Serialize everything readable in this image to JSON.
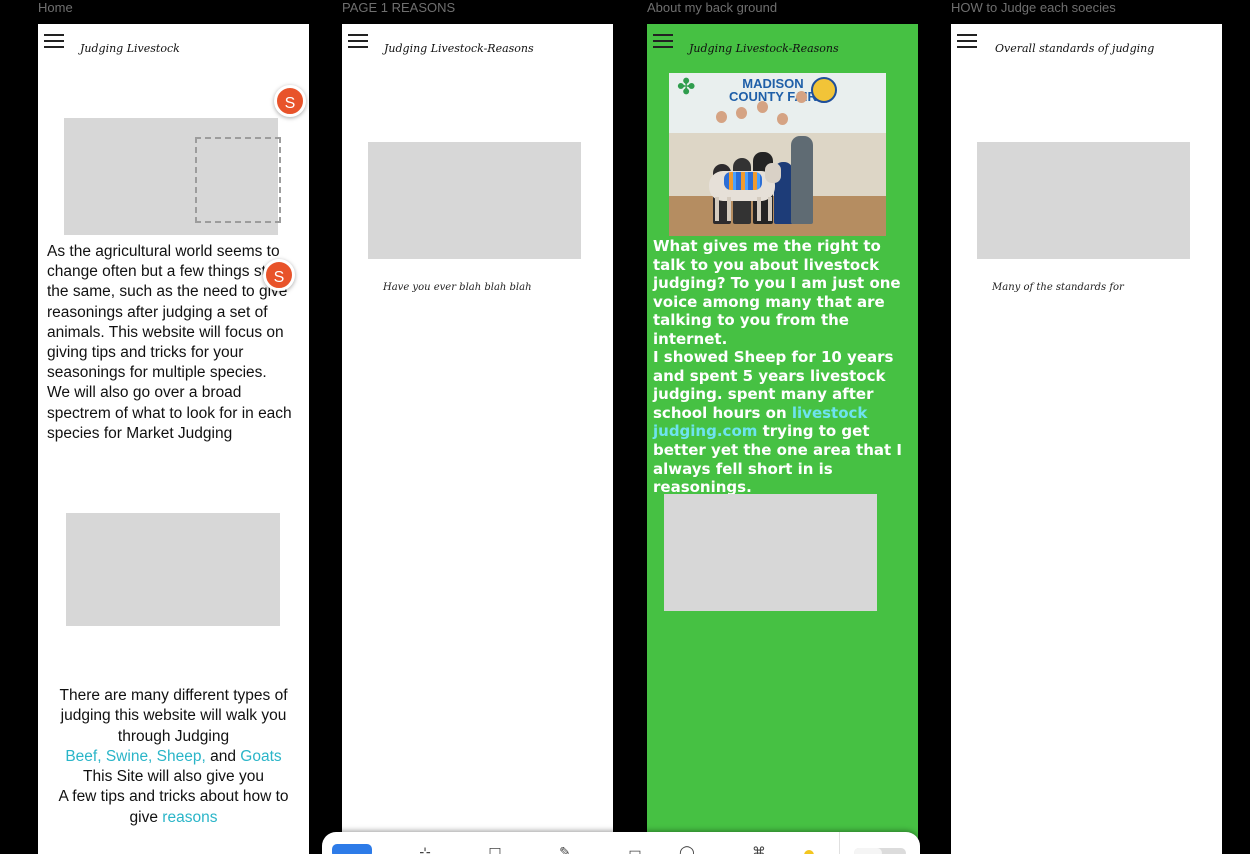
{
  "frames": [
    {
      "label": "Home",
      "site_title": "Judging Livestock",
      "avatar_letter": "S",
      "intro_text": "As the agricultural world seems to change often but a few things stay the same, such as the need to give reasonings after judging a set of animals. This website will focus on giving tips and tricks for your seasonings for multiple species.\nWe will also go over a broad spectrem of what to look for in each species for Market Judging",
      "bottom_line1": "There are many different types of judging this website will walk you through Judging",
      "bottom_species": "Beef, Swine, Sheep,",
      "bottom_and": " and ",
      "bottom_goats": "Goats",
      "bottom_line2": "This Site will also give you",
      "bottom_line3": "A few tips and tricks about how to give ",
      "bottom_reasons": "reasons"
    },
    {
      "label": "PAGE 1 REASONS",
      "site_title": "Judging Livestock-Reasons",
      "cursive_text": "Have you ever blah blah blah"
    },
    {
      "label": "About my back ground",
      "site_title": "Judging Livestock-Reasons",
      "photo_banner": "MADISON COUNTY FAIR",
      "para1": "What gives me the right to talk to you about livestock judging? To you I am just one voice among many that are talking to you from the internet.",
      "para2_before": "I showed Sheep for 10 years and spent 5 years livestock judging. spent many after school hours on ",
      "para2_link": "livestock judging.com",
      "para2_after": " trying to get better yet the one area that I always fell short in is reasonings."
    },
    {
      "label": "HOW to Judge each soecies",
      "site_title": "Overall standards of judging",
      "cursive_text": "Many of the standards for"
    }
  ],
  "dock": {
    "icons": [
      "select-tool-icon",
      "frame-tool-icon",
      "rectangle-tool-icon",
      "pen-tool-icon",
      "text-tool-icon",
      "comment-icon",
      "assets-icon",
      "emoji-icon",
      "mode-toggle-icon"
    ],
    "glyphs": [
      "▭",
      "⊹",
      "□",
      "✎",
      "▭",
      "◯",
      "⌘",
      "●",
      ""
    ],
    "accent": "#2d7be8"
  },
  "colors": {
    "background": "#000000",
    "green_page": "#46c143",
    "teal_link": "#2ab5c8",
    "avatar": "#e8532a"
  }
}
